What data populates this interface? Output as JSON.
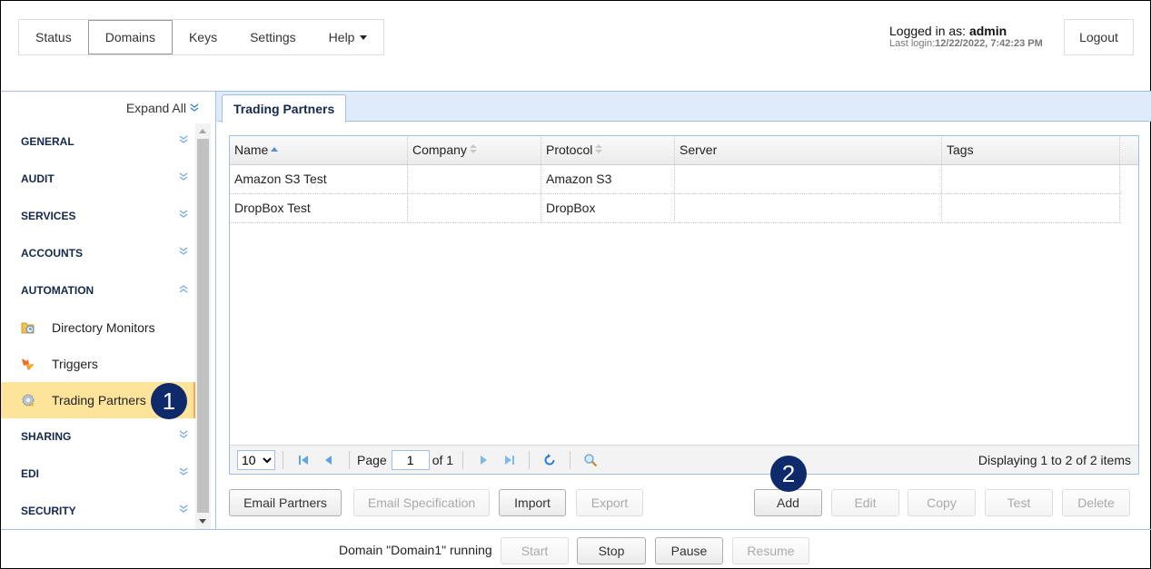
{
  "topnav": {
    "items": [
      {
        "label": "Status",
        "active": false
      },
      {
        "label": "Domains",
        "active": true
      },
      {
        "label": "Keys",
        "active": false
      },
      {
        "label": "Settings",
        "active": false
      },
      {
        "label": "Help",
        "active": false,
        "dropdown": true
      }
    ]
  },
  "user": {
    "logged_in_prefix": "Logged in as: ",
    "username": "admin",
    "last_login_prefix": "Last login:",
    "last_login": "12/22/2022, 7:42:23 PM",
    "logout_label": "Logout"
  },
  "sidebar": {
    "expand_all_label": "Expand All",
    "sections": [
      {
        "label": "GENERAL",
        "state": "collapsed"
      },
      {
        "label": "AUDIT",
        "state": "collapsed"
      },
      {
        "label": "SERVICES",
        "state": "collapsed"
      },
      {
        "label": "ACCOUNTS",
        "state": "collapsed"
      },
      {
        "label": "AUTOMATION",
        "state": "expanded"
      },
      {
        "label": "SHARING",
        "state": "collapsed"
      },
      {
        "label": "EDI",
        "state": "collapsed"
      },
      {
        "label": "SECURITY",
        "state": "collapsed"
      }
    ],
    "automation_items": [
      {
        "label": "Directory Monitors",
        "icon": "folder-clock-icon"
      },
      {
        "label": "Triggers",
        "icon": "trigger-arrow-icon"
      },
      {
        "label": "Trading Partners",
        "icon": "gear-partner-icon",
        "active": true
      }
    ]
  },
  "annotations": {
    "step1": "1",
    "step2": "2"
  },
  "main": {
    "tab_label": "Trading Partners",
    "table": {
      "columns": [
        {
          "label": "Name",
          "sort": "asc"
        },
        {
          "label": "Company",
          "sort": "none"
        },
        {
          "label": "Protocol",
          "sort": "none"
        },
        {
          "label": "Server",
          "sort": null
        },
        {
          "label": "Tags",
          "sort": null
        }
      ],
      "rows": [
        [
          "Amazon S3 Test",
          "",
          "Amazon S3",
          "",
          ""
        ],
        [
          "DropBox Test",
          "",
          "DropBox",
          "",
          ""
        ]
      ]
    },
    "pager": {
      "page_size": "10",
      "page_label": "Page",
      "current_page": "1",
      "of_label": "of 1",
      "display_info": "Displaying 1 to 2 of 2 items"
    },
    "buttons": {
      "email_partners": "Email Partners",
      "email_specification": "Email Specification",
      "import": "Import",
      "export": "Export",
      "add": "Add",
      "edit": "Edit",
      "copy": "Copy",
      "test": "Test",
      "delete": "Delete"
    }
  },
  "footer": {
    "status": "Domain \"Domain1\" running",
    "start": "Start",
    "stop": "Stop",
    "pause": "Pause",
    "resume": "Resume"
  }
}
